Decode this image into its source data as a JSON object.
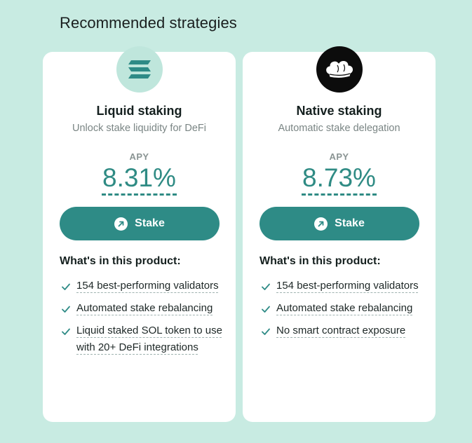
{
  "section_title": "Recommended strategies",
  "cards": [
    {
      "logo_icon": "solana-logo-icon",
      "title": "Liquid staking",
      "subtitle": "Unlock stake liquidity for DeFi",
      "apy_label": "APY",
      "apy_value": "8.31%",
      "button_label": "Stake",
      "button_icon": "arrow-up-right-icon",
      "included_heading": "What's in this product:",
      "features": [
        "154 best-performing validators",
        "Automated stake rebalancing",
        "Liquid staked SOL token to use with 20+ DeFi integrations"
      ]
    },
    {
      "logo_icon": "chef-hat-logo-icon",
      "title": "Native staking",
      "subtitle": "Automatic stake delegation",
      "apy_label": "APY",
      "apy_value": "8.73%",
      "button_label": "Stake",
      "button_icon": "arrow-up-right-icon",
      "included_heading": "What's in this product:",
      "features": [
        "154 best-performing validators",
        "Automated stake rebalancing",
        "No smart contract exposure"
      ]
    }
  ],
  "colors": {
    "background": "#c8ebe2",
    "accent": "#2e8b86",
    "apy": "#2f8b84",
    "card": "#ffffff"
  }
}
